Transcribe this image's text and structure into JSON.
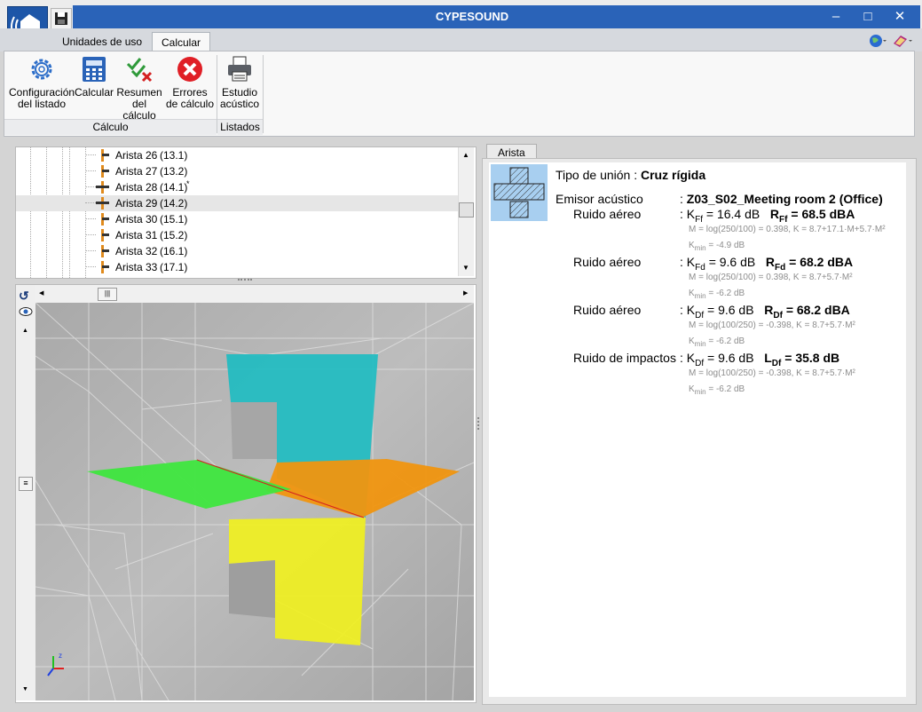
{
  "window": {
    "title": "CYPESOUND"
  },
  "tabs": [
    {
      "label": "Unidades de uso"
    },
    {
      "label": "Calcular"
    }
  ],
  "ribbon": {
    "buttons": [
      {
        "label": "Configuración del listado",
        "icon": "gear-icon"
      },
      {
        "label": "Calcular",
        "icon": "calculator-icon"
      },
      {
        "label": "Resumen del cálculo",
        "icon": "check-cross-icon"
      },
      {
        "label": "Errores de cálculo",
        "icon": "error-circle-icon"
      },
      {
        "label": "Estudio acústico",
        "icon": "printer-icon"
      }
    ],
    "groups": [
      {
        "label": "Cálculo"
      },
      {
        "label": "Listados"
      }
    ]
  },
  "tree": {
    "items": [
      {
        "label": "Arista 26",
        "code": "(13.1)",
        "mark": ""
      },
      {
        "label": "Arista 27",
        "code": "(13.2)",
        "mark": ""
      },
      {
        "label": "Arista 28",
        "code": "(14.1)",
        "mark": "*"
      },
      {
        "label": "Arista 29",
        "code": "(14.2)",
        "mark": ""
      },
      {
        "label": "Arista 30",
        "code": "(15.1)",
        "mark": ""
      },
      {
        "label": "Arista 31",
        "code": "(15.2)",
        "mark": ""
      },
      {
        "label": "Arista 32",
        "code": "(16.1)",
        "mark": ""
      },
      {
        "label": "Arista 33",
        "code": "(17.1)",
        "mark": ""
      }
    ],
    "selected_index": 3
  },
  "viewer": {
    "colors": {
      "cyan": "#1fbcc1",
      "orange": "#f0950f",
      "green": "#3ee63e",
      "yellow": "#f0f020"
    }
  },
  "panel": {
    "tab": "Arista",
    "union_label": "Tipo de unión",
    "union_value": "Cruz rígida",
    "emitter_label": "Emisor acústico",
    "emitter_value": "Z03_S02_Meeting room 2 (Office)",
    "entries": [
      {
        "label": "Ruido aéreo",
        "k": "K",
        "k_sub": "Ff",
        "k_val": "= 16.4 dB",
        "r": "R",
        "r_sub": "Ff",
        "r_val": "= 68.5 dBA",
        "formula": "M = log(250/100) = 0.398, K = 8.7+17.1·M+5.7·M²",
        "kmin": "K",
        "kmin_sub": "min",
        "kmin_val": "= -4.9 dB"
      },
      {
        "label": "Ruido aéreo",
        "k": "K",
        "k_sub": "Fd",
        "k_val": "= 9.6 dB",
        "r": "R",
        "r_sub": "Fd",
        "r_val": "= 68.2 dBA",
        "formula": "M = log(250/100) = 0.398, K = 8.7+5.7·M²",
        "kmin": "K",
        "kmin_sub": "min",
        "kmin_val": "= -6.2 dB"
      },
      {
        "label": "Ruido aéreo",
        "k": "K",
        "k_sub": "Df",
        "k_val": "= 9.6 dB",
        "r": "R",
        "r_sub": "Df",
        "r_val": "= 68.2 dBA",
        "formula": "M = log(100/250) = -0.398, K = 8.7+5.7·M²",
        "kmin": "K",
        "kmin_sub": "min",
        "kmin_val": "= -6.2 dB"
      },
      {
        "label": "Ruido de impactos",
        "k": "K",
        "k_sub": "Df",
        "k_val": "= 9.6 dB",
        "r": "L",
        "r_sub": "Df",
        "r_val": "= 35.8 dB",
        "formula": "M = log(100/250) = -0.398, K = 8.7+5.7·M²",
        "kmin": "K",
        "kmin_sub": "min",
        "kmin_val": "= -6.2 dB"
      }
    ]
  }
}
